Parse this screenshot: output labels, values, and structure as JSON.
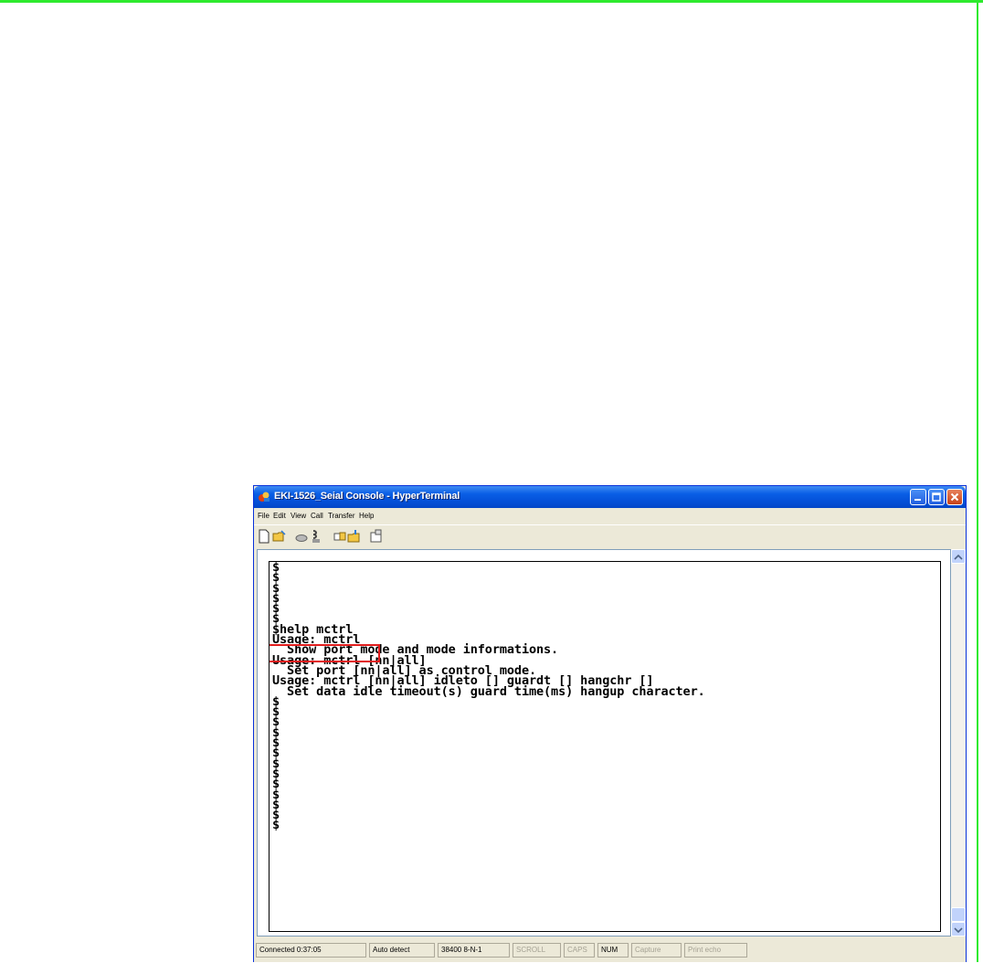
{
  "window": {
    "title": "EKI-1526_Seial Console - HyperTerminal",
    "menu": [
      "File",
      "Edit",
      "View",
      "Call",
      "Transfer",
      "Help"
    ],
    "toolbar_icons": [
      "new-document-icon",
      "open-folder-icon",
      "connect-phone-icon",
      "disconnect-phone-icon",
      "send-icon",
      "receive-icon",
      "properties-icon"
    ]
  },
  "terminal": {
    "lines": [
      "$",
      "$",
      "$",
      "$",
      "$",
      "$",
      "$help mctrl",
      "Usage: mctrl",
      "  Show port mode and mode informations.",
      "Usage: mctrl [nn|all]",
      "  Set port [nn|all] as control mode.",
      "Usage: mctrl [nn|all] idleto [] guardt [] hangchr []",
      "  Set data idle timeout(s) guard time(ms) hangup character.",
      "$",
      "$",
      "$",
      "$",
      "$",
      "$",
      "$",
      "$",
      "$",
      "$",
      "$",
      "$",
      "$"
    ]
  },
  "status": {
    "connected": "Connected 0:37:05",
    "detect": "Auto detect",
    "port": "38400 8-N-1",
    "scroll": "SCROLL",
    "caps": "CAPS",
    "num": "NUM",
    "capture": "Capture",
    "print_echo": "Print echo"
  },
  "colors": {
    "accent_rule": "#2eea2e",
    "titlebar": "#0450d8",
    "highlight": "#e11d1d"
  }
}
